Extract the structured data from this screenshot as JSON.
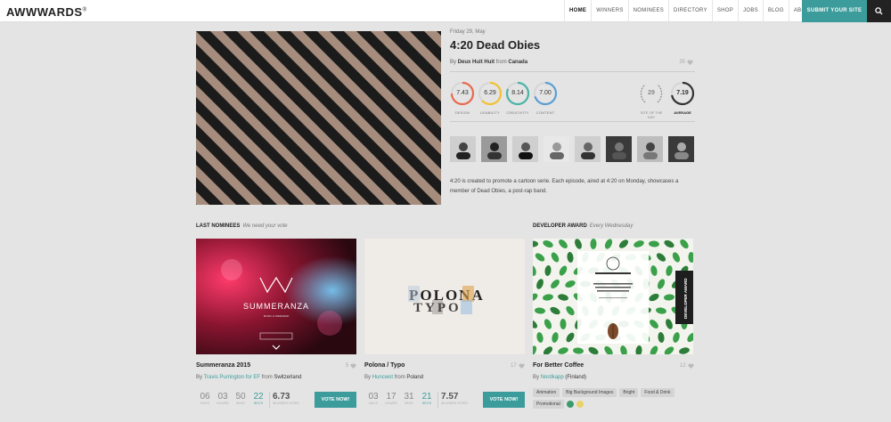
{
  "header": {
    "logo": "AWWWARDS",
    "logo_mark": "®",
    "nav": [
      "HOME",
      "WINNERS",
      "NOMINEES",
      "DIRECTORY",
      "SHOP",
      "JOBS",
      "BLOG",
      "ABOUT US"
    ],
    "submit_label": "SUBMIT YOUR SITE",
    "search_icon": "search-icon"
  },
  "hero": {
    "date": "Friday 29, May",
    "title": "4:20 Dead Obies",
    "by_prefix": "By",
    "author": "Deux Huit Huit",
    "from_prefix": "from",
    "country": "Canada",
    "likes": "35",
    "scores": [
      {
        "label": "DESIGN",
        "value": "7.43",
        "color": "#e86a4f"
      },
      {
        "label": "USABILITY",
        "value": "6.29",
        "color": "#f2c232"
      },
      {
        "label": "CREATIVITY",
        "value": "8.14",
        "color": "#4ab4a6"
      },
      {
        "label": "CONTENT",
        "value": "7.00",
        "color": "#5a9fd4"
      }
    ],
    "sotd_number": "29",
    "sotd_label": "SITE OF THE DAY",
    "average_label": "AVERAGE",
    "average_value": "7.19",
    "average_color": "#333333",
    "description": "4:20 is created to promote a cartoon serie. Each episode, aired at 4:20 on Monday, showcases a member of Dead Obies, a post-rap band."
  },
  "sections": {
    "nominees_title": "LAST NOMINEES",
    "nominees_sub": "We need your vote",
    "dev_title": "DEVELOPER AWARD",
    "dev_sub": "Every Wednesday"
  },
  "cards": [
    {
      "title": "Summeranza 2015",
      "likes": "5",
      "by": "By",
      "author": "Travis Purrington for EF",
      "from": "from",
      "country": "Switzerland",
      "timer": [
        {
          "n": "06",
          "u": "DAYS"
        },
        {
          "n": "03",
          "u": "HOURS"
        },
        {
          "n": "50",
          "u": "MINS"
        },
        {
          "n": "22",
          "u": "SECS"
        }
      ],
      "score": "6.73",
      "score_label": "36 USERS VOTES",
      "vote": "VOTE NOW!",
      "img_text": "SUMMERANZA",
      "img_sub": "MUSIC & WEEKEND"
    },
    {
      "title": "Polona / Typo",
      "likes": "17",
      "by": "By",
      "author": "Huncwot",
      "from": "from",
      "country": "Poland",
      "timer": [
        {
          "n": "03",
          "u": "DAYS"
        },
        {
          "n": "17",
          "u": "HOURS"
        },
        {
          "n": "31",
          "u": "MINS"
        },
        {
          "n": "21",
          "u": "SECS"
        }
      ],
      "score": "7.57",
      "score_label": "36 USERS VOTES",
      "vote": "VOTE NOW!",
      "img_text": "POLONA",
      "img_text2": "TYPO"
    },
    {
      "title": "For Better Coffee",
      "likes": "12",
      "by": "By",
      "author": "Nordkapp",
      "from": "",
      "country": "(Finland)",
      "tags": [
        "Animation",
        "Big Background Images",
        "Bright",
        "Food & Drink",
        "Promotional"
      ],
      "colors": [
        "#3b9c6b",
        "#e8d36a"
      ],
      "badge": "DEVELOPER AWARD"
    }
  ]
}
